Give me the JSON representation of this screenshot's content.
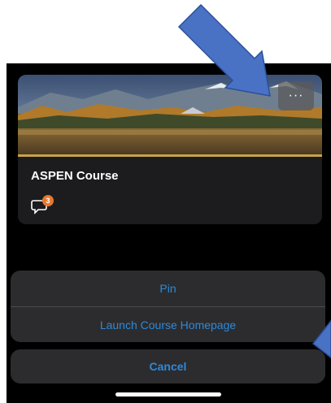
{
  "course_card": {
    "title": "ASPEN Course",
    "more_label": "···",
    "unread_count": "3"
  },
  "action_sheet": {
    "items": [
      {
        "label": "Pin"
      },
      {
        "label": "Launch Course Homepage"
      }
    ],
    "cancel_label": "Cancel"
  },
  "colors": {
    "background": "#000000",
    "card": "#1c1c1e",
    "sheet": "#2c2c2e",
    "accent": "#2e89d8",
    "badge": "#e8772e",
    "annotation_arrow": "#4a72c4"
  },
  "icons": [
    "more-horizontal-icon",
    "discussion-icon",
    "annotation-arrow-icon"
  ]
}
